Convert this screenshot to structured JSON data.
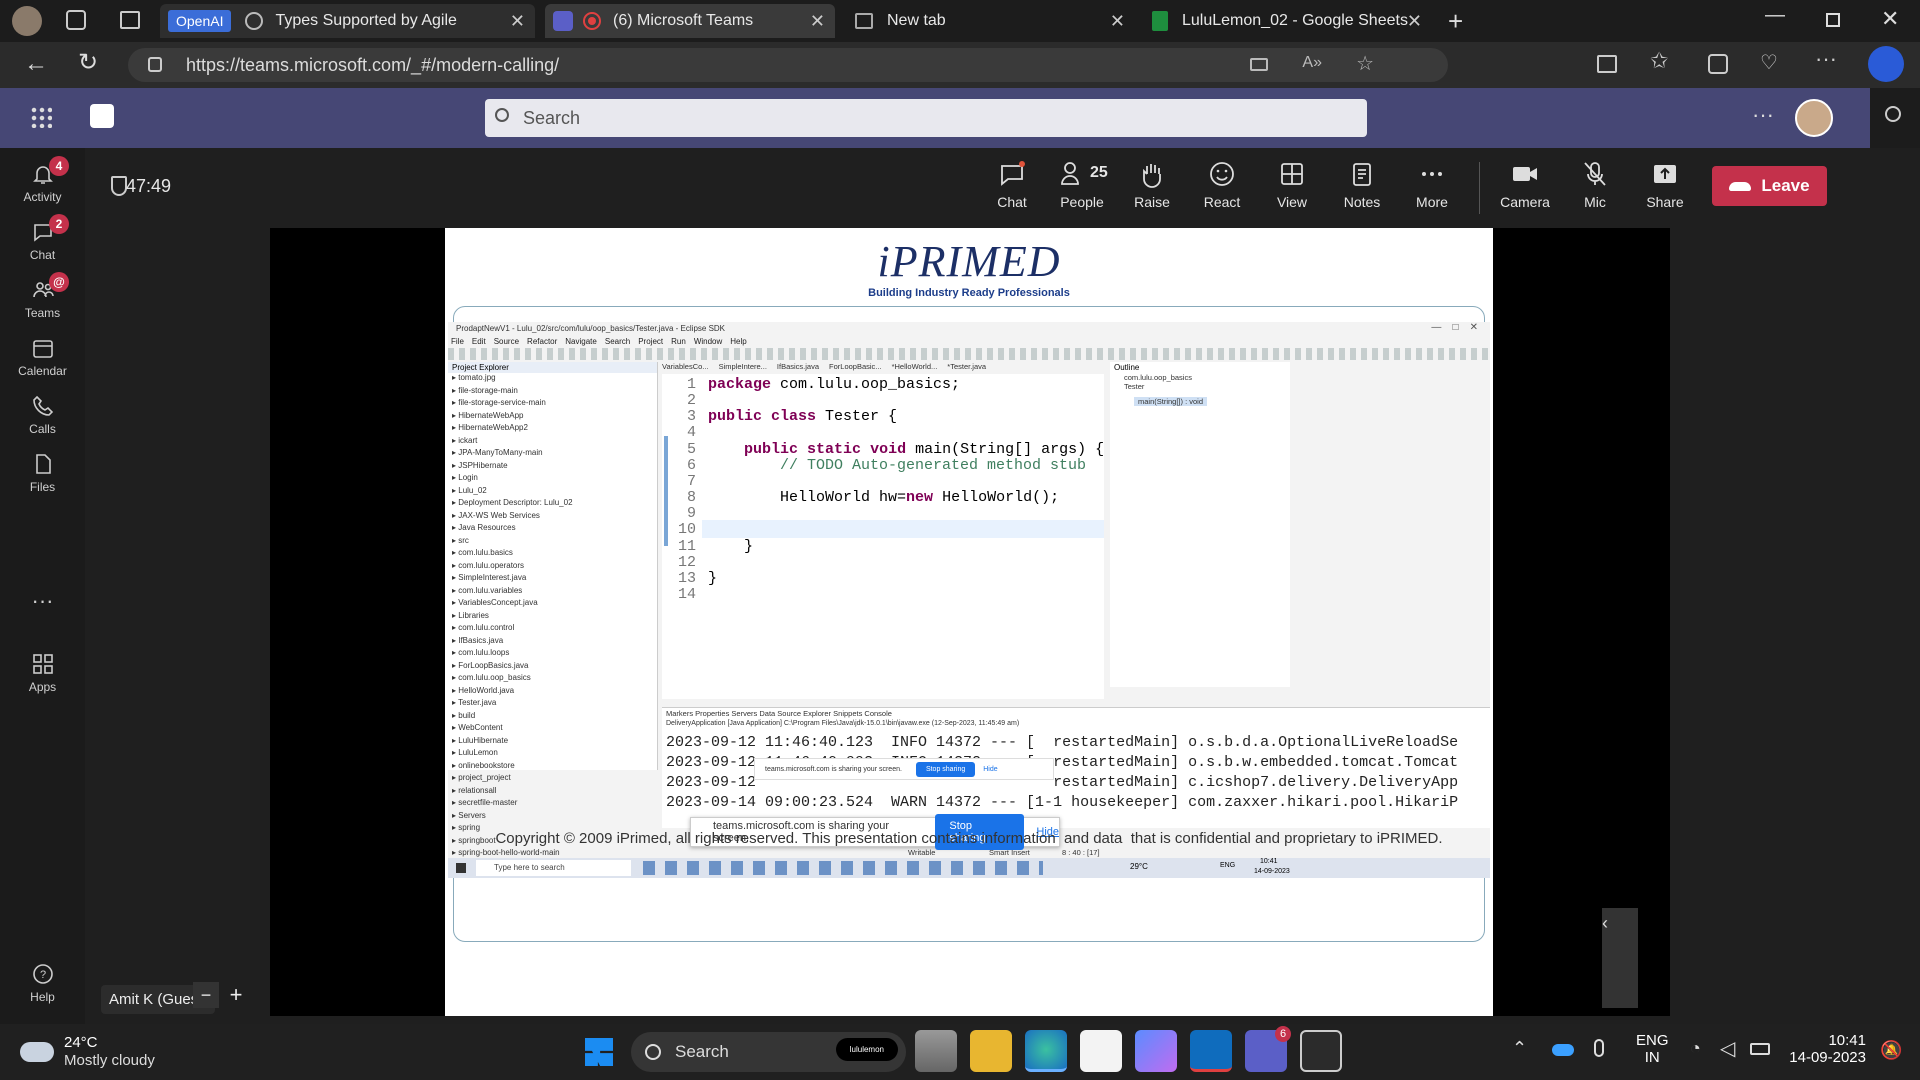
{
  "browser": {
    "tabs": [
      {
        "label": "OpenAI",
        "title": "Types Supported by Agile"
      },
      {
        "title": "(6) Microsoft Teams"
      },
      {
        "title": "New tab"
      },
      {
        "title": "LuluLemon_02 - Google Sheets"
      }
    ],
    "url": "https://teams.microsoft.com/_#/modern-calling/"
  },
  "teams": {
    "search_placeholder": "Search",
    "rail": [
      {
        "label": "Activity",
        "badge": "4"
      },
      {
        "label": "Chat",
        "badge": "2"
      },
      {
        "label": "Teams",
        "badge": "@"
      },
      {
        "label": "Calendar"
      },
      {
        "label": "Calls"
      },
      {
        "label": "Files"
      },
      {
        "label": "Apps"
      },
      {
        "label": "Help"
      }
    ],
    "meeting": {
      "timer": "47:49",
      "people_count": "25",
      "controls": [
        "Chat",
        "People",
        "Raise",
        "React",
        "View",
        "Notes",
        "More",
        "Camera",
        "Mic",
        "Share"
      ],
      "leave_label": "Leave",
      "participant_name": "Amit K (Guest)"
    }
  },
  "slide": {
    "logo_text": "iPRIMED",
    "tagline": "Building Industry Ready Professionals",
    "copyright": "Copyright © 2009 iPrimed, all rights reserved. This presentation contains information  and data  that is confidential and proprietary to iPRIMED.",
    "eclipse": {
      "title": "ProdaptNewV1 - Lulu_02/src/com/lulu/oop_basics/Tester.java - Eclipse SDK",
      "menu": [
        "File",
        "Edit",
        "Source",
        "Refactor",
        "Navigate",
        "Search",
        "Project",
        "Run",
        "Window",
        "Help"
      ],
      "explorer_title": "Project Explorer",
      "tree": [
        "tomato.jpg",
        "file-storage-main",
        "file-storage-service-main",
        "HibernateWebApp",
        "HibernateWebApp2",
        "ickart",
        "JPA-ManyToMany-main",
        "JSPHibernate",
        "Login",
        "Lulu_02",
        "Deployment Descriptor: Lulu_02",
        "JAX-WS Web Services",
        "Java Resources",
        "src",
        "com.lulu.basics",
        "com.lulu.operators",
        "SimpleInterest.java",
        "com.lulu.variables",
        "VariablesConcept.java",
        "Libraries",
        "com.lulu.control",
        "IfBasics.java",
        "com.lulu.loops",
        "ForLoopBasics.java",
        "com.lulu.oop_basics",
        "HelloWorld.java",
        "Tester.java",
        "build",
        "WebContent",
        "LuluHibernate",
        "LuluLemon",
        "onlinebookstore",
        "project_project",
        "relationsall",
        "secretfile-master",
        "Servers",
        "spring",
        "springboot",
        "spring-boot-hello-world-main"
      ],
      "editor_tabs": [
        "VariablesCo...",
        "SimpleIntere...",
        "IfBasics.java",
        "ForLoopBasic...",
        "*HelloWorld...",
        "*Tester.java"
      ],
      "code": [
        "package com.lulu.oop_basics;",
        "",
        "public class Tester {",
        "",
        "    public static void main(String[] args) {",
        "        // TODO Auto-generated method stub",
        "",
        "        HelloWorld hw=new HelloWorld();",
        "",
        "",
        "    }",
        "",
        "}",
        ""
      ],
      "outline_title": "Outline",
      "outline": [
        "com.lulu.oop_basics",
        "Tester",
        "main(String[]) : void"
      ],
      "console_tabs": "Markers  Properties  Servers  Data Source Explorer  Snippets  Console",
      "console_header": "DeliveryApplication [Java Application] C:\\Program Files\\Java\\jdk-15.0.1\\bin\\javaw.exe  (12-Sep-2023, 11:45:49 am)",
      "console": [
        "2023-09-12 11:46:40.123  INFO 14372 --- [  restartedMain] o.s.b.d.a.OptionalLiveReloadSe",
        "2023-09-12 11:46:40.993  INFO 14372 --- [  restartedMain] o.s.b.w.embedded.tomcat.Tomcat",
        "2023-09-12                                 restartedMain] c.icshop7.delivery.DeliveryApp",
        "2023-09-14 09:00:23.524  WARN 14372 --- [1-1 housekeeper] com.zaxxer.hikari.pool.HikariP"
      ],
      "share_notice": "teams.microsoft.com is sharing your screen.",
      "stop_sharing": "Stop sharing",
      "hide": "Hide",
      "status": [
        "Writable",
        "Smart Insert",
        "8 : 40 : [17]"
      ],
      "inner_taskbar": {
        "search": "Type here to search",
        "weather": "29°C",
        "lang": "ENG",
        "time": "10:41",
        "date": "14-09-2023"
      }
    }
  },
  "taskbar": {
    "weather_temp": "24°C",
    "weather_desc": "Mostly cloudy",
    "search": "Search",
    "search_chip": "lululemon",
    "teams_badge": "6",
    "lang1": "ENG",
    "lang2": "IN",
    "time": "10:41",
    "date": "14-09-2023"
  }
}
